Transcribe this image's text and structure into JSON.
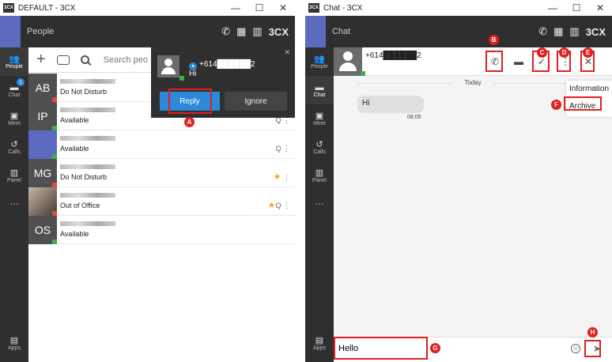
{
  "left_window": {
    "title": "DEFAULT - 3CX",
    "header_title": "People",
    "brand": "3CX",
    "sidebar": [
      {
        "label": "People",
        "active": true
      },
      {
        "label": "Chat",
        "badge": "1"
      },
      {
        "label": "Meet"
      },
      {
        "label": "Calls"
      },
      {
        "label": "Panel"
      },
      {
        "label": "···"
      }
    ],
    "apps_label": "Apps",
    "search": {
      "placeholder": "Search peo"
    },
    "contacts": [
      {
        "initials": "AB",
        "status": "Do Not Disturb",
        "status_color": "red"
      },
      {
        "initials": "IP",
        "status": "Available",
        "status_color": "green"
      },
      {
        "initials": "",
        "status": "Available",
        "status_color": "green"
      },
      {
        "initials": "MG",
        "status": "Do Not Disturb",
        "status_color": "red",
        "starred": true
      },
      {
        "initials": "",
        "status": "Out of Office",
        "status_color": "red",
        "starred": true
      },
      {
        "initials": "OS",
        "status": "Available",
        "status_color": "green"
      }
    ],
    "notification": {
      "number": "+614██████2",
      "message": "Hi",
      "reply_label": "Reply",
      "ignore_label": "Ignore"
    }
  },
  "right_window": {
    "title": "Chat - 3CX",
    "header_title": "Chat",
    "brand": "3CX",
    "sidebar": [
      {
        "label": "People"
      },
      {
        "label": "Chat",
        "active": true
      },
      {
        "label": "Meet"
      },
      {
        "label": "Calls"
      },
      {
        "label": "Panel"
      },
      {
        "label": "···"
      }
    ],
    "apps_label": "Apps",
    "contact_number": "+614██████2",
    "date_divider": "Today",
    "messages": [
      {
        "text": "Hi",
        "time": "08:05"
      }
    ],
    "menu": {
      "items": [
        "Information",
        "Archive"
      ]
    },
    "composer": {
      "value": "Hello"
    }
  },
  "callouts": [
    "A",
    "B",
    "C",
    "D",
    "E",
    "F",
    "G",
    "H"
  ],
  "colors": {
    "accent": "#2d89d8",
    "callout": "#e02020",
    "available": "#3cb043",
    "busy": "#e34a3b"
  }
}
